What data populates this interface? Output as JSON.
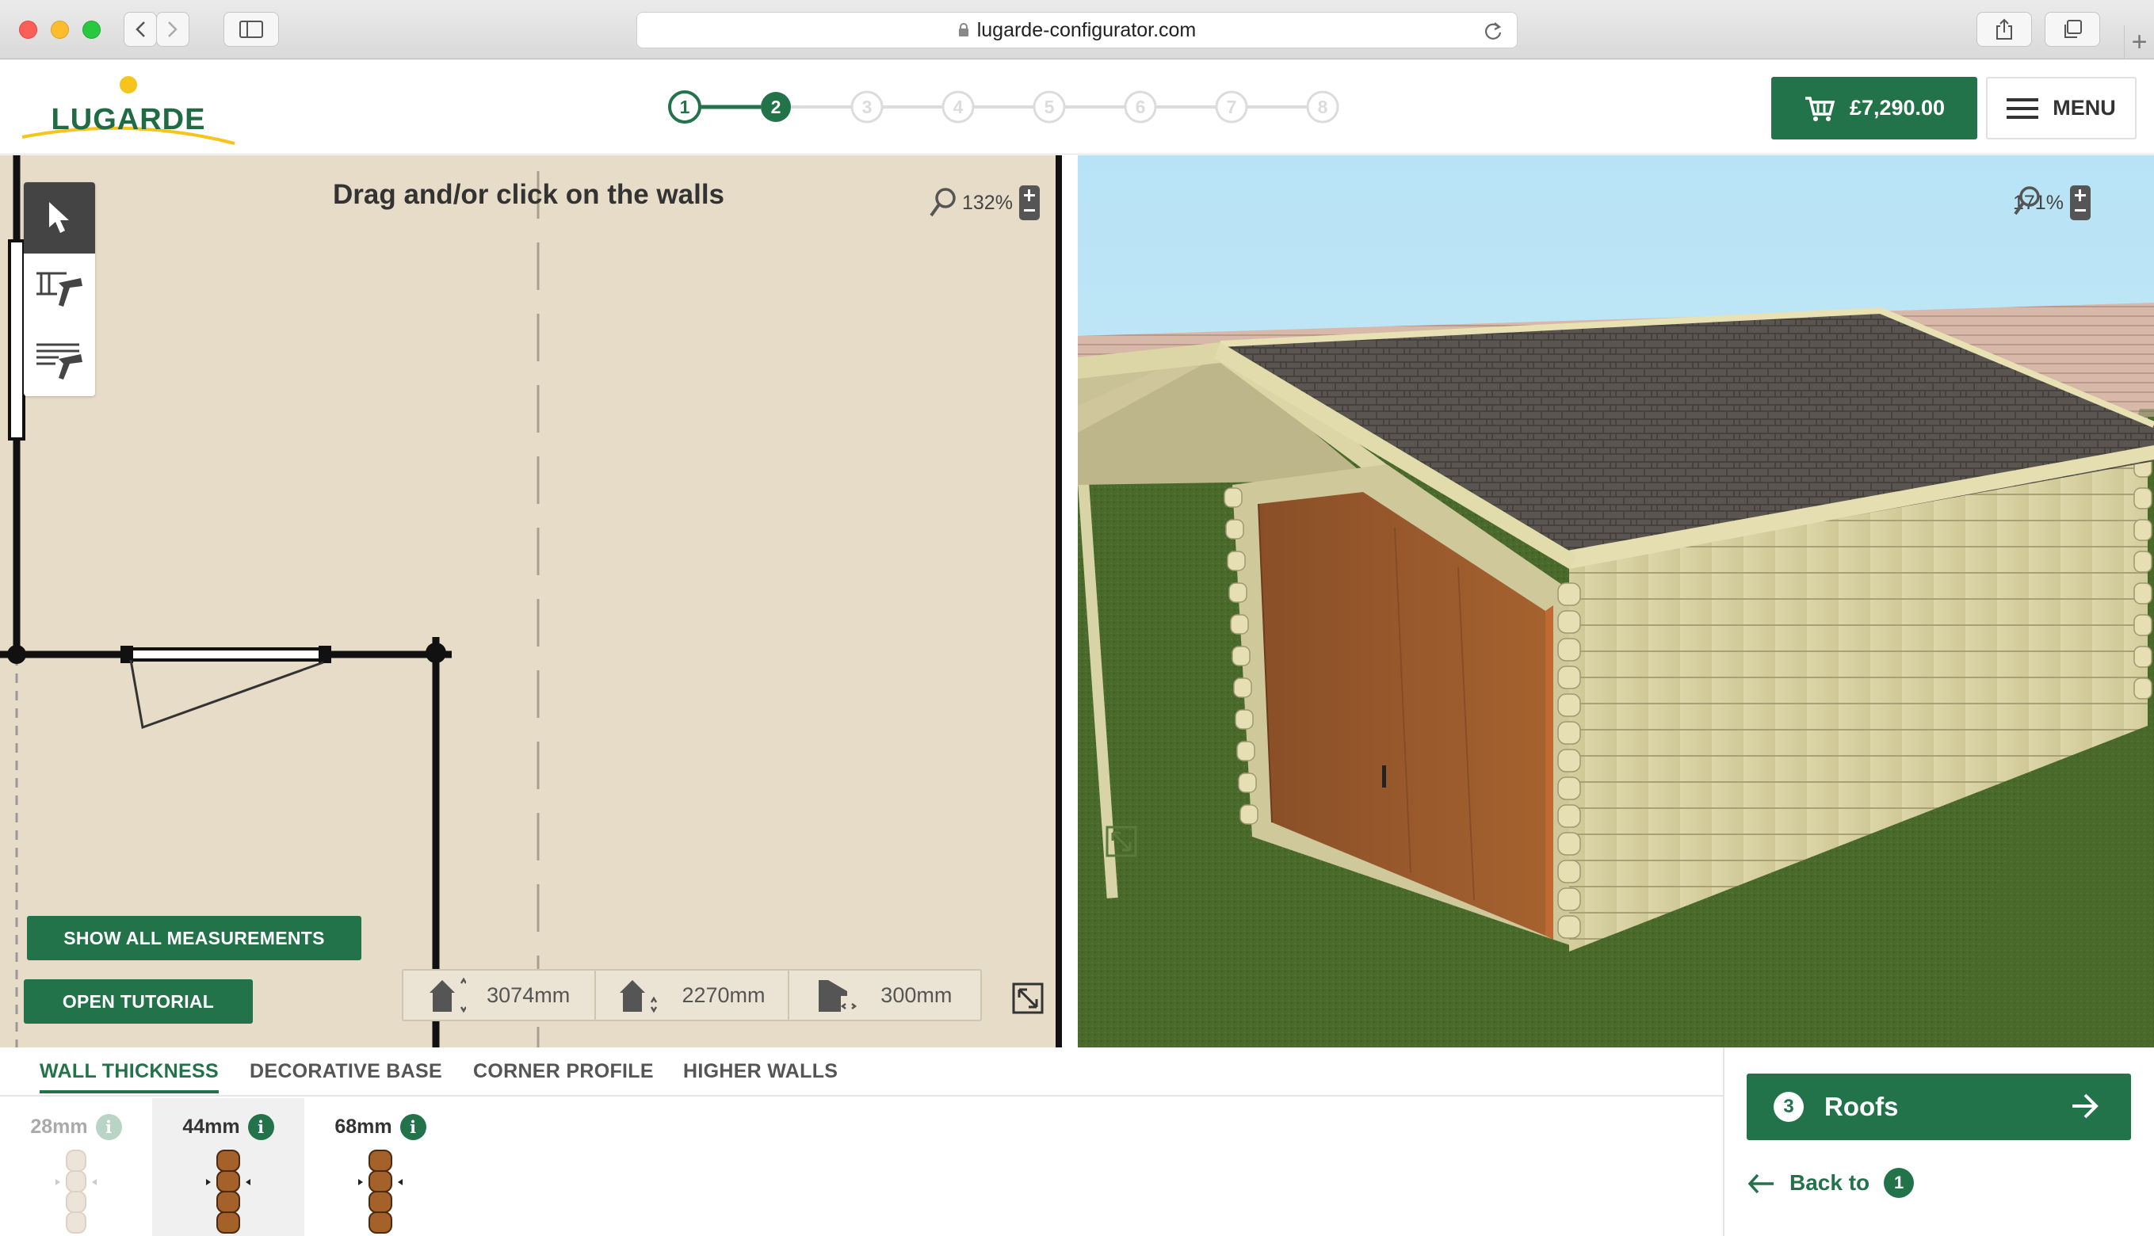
{
  "browser": {
    "url": "lugarde-configurator.com"
  },
  "header": {
    "logo_text": "LUGARDE",
    "steps": [
      "1",
      "2",
      "3",
      "4",
      "5",
      "6",
      "7",
      "8"
    ],
    "current_step": 2,
    "cart_total": "£7,290.00",
    "menu_label": "MENU"
  },
  "plan": {
    "hint": "Drag and/or click on the walls",
    "zoom": "132%",
    "tools": [
      "select-icon",
      "wall-tool-icon",
      "log-wall-tool-icon"
    ],
    "show_measurements_label": "SHOW ALL MEASUREMENTS",
    "open_tutorial_label": "OPEN TUTORIAL",
    "measurements": [
      {
        "icon": "wall-height-icon",
        "value": "3074mm"
      },
      {
        "icon": "eave-height-icon",
        "value": "2270mm"
      },
      {
        "icon": "overhang-icon",
        "value": "300mm"
      }
    ]
  },
  "view3d": {
    "zoom": "171%"
  },
  "bottom": {
    "tabs": [
      "WALL THICKNESS",
      "DECORATIVE BASE",
      "CORNER PROFILE",
      "HIGHER WALLS"
    ],
    "active_tab": 0,
    "options": [
      {
        "label": "28mm",
        "selected": false,
        "available": false
      },
      {
        "label": "44mm",
        "selected": true,
        "available": true
      },
      {
        "label": "68mm",
        "selected": false,
        "available": true
      }
    ],
    "next": {
      "number": "3",
      "label": "Roofs"
    },
    "back": {
      "label": "Back to",
      "number": "1"
    }
  },
  "colors": {
    "brand_green": "#23734a",
    "plan_background": "#e6dcc8",
    "sky": "#bfe6f7",
    "grass": "#4a6a2b"
  }
}
